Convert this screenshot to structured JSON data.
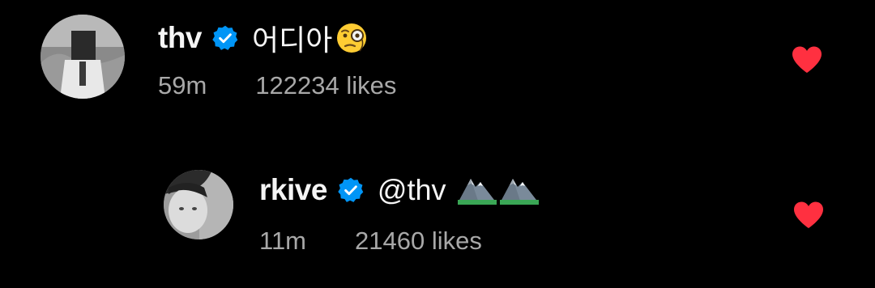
{
  "comments": [
    {
      "username": "thv",
      "verified": true,
      "text": "어디아",
      "emoji": "face-with-monocle",
      "time": "59m",
      "likes": "122234 likes",
      "liked": true
    },
    {
      "username": "rkive",
      "verified": true,
      "text": "@thv",
      "emoji": "mountain",
      "emoji_count": 2,
      "time": "11m",
      "likes": "21460 likes",
      "liked": true
    }
  ],
  "colors": {
    "background": "#000000",
    "verified_badge": "#0095f6",
    "heart": "#ff3040",
    "meta_text": "#a8a8a8"
  }
}
